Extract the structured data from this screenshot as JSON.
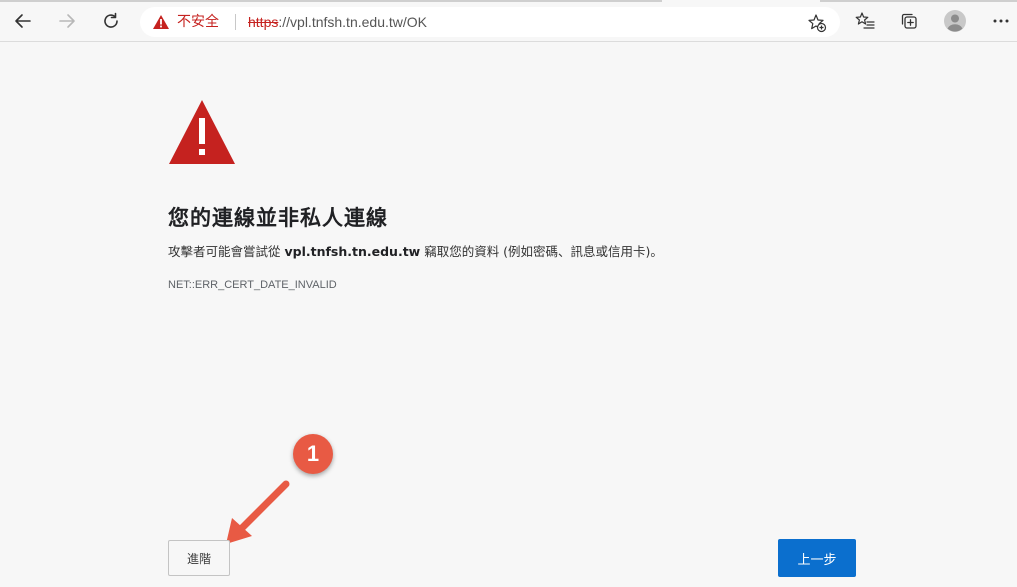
{
  "browser": {
    "address_bar": {
      "security_label": "不安全",
      "url_scheme": "https",
      "url_rest": "://vpl.tnfsh.tn.edu.tw/OK"
    },
    "icons": {
      "back": "back-arrow-icon",
      "forward": "forward-arrow-icon",
      "refresh": "refresh-icon",
      "security_warning": "warning-triangle-icon",
      "add_favorite": "star-add-icon",
      "favorites": "favorites-list-icon",
      "collections": "collections-icon",
      "profile": "profile-avatar-icon",
      "menu": "more-dots-icon"
    }
  },
  "page": {
    "heading": "您的連線並非私人連線",
    "description_prefix": "攻擊者可能會嘗試從 ",
    "description_host": "vpl.tnfsh.tn.edu.tw",
    "description_suffix": " 竊取您的資料 (例如密碼、訊息或信用卡)。",
    "error_code": "NET::ERR_CERT_DATE_INVALID",
    "advanced_button": "進階",
    "back_button": "上一步"
  },
  "annotation": {
    "step_number": "1"
  },
  "colors": {
    "warning_red": "#c5221f",
    "primary_blue": "#0b6fce",
    "annotation_orange": "#e85a44"
  }
}
